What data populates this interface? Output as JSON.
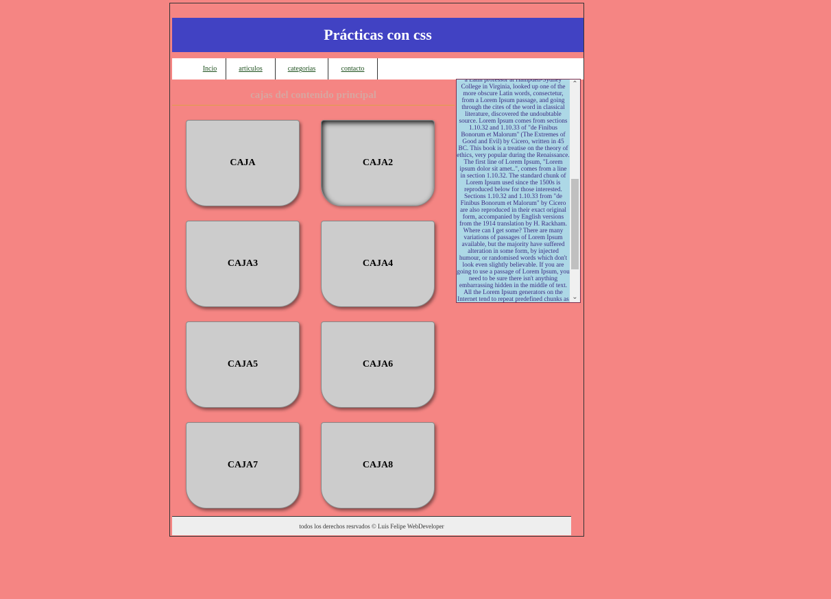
{
  "header": {
    "title": "Prácticas con css"
  },
  "nav": {
    "items": [
      {
        "label": "Incio"
      },
      {
        "label": "articulos"
      },
      {
        "label": "categorias"
      },
      {
        "label": "contacto"
      }
    ]
  },
  "main": {
    "subtitle": "cajas del contenido principal",
    "boxes": [
      {
        "label": "CAJA"
      },
      {
        "label": "CAJA2"
      },
      {
        "label": "CAJA3"
      },
      {
        "label": "CAJA4"
      },
      {
        "label": "CAJA5"
      },
      {
        "label": "CAJA6"
      },
      {
        "label": "CAJA7"
      },
      {
        "label": "CAJA8"
      }
    ]
  },
  "aside": {
    "text": "a Latin professor at Hampden-Sydney College in Virginia, looked up one of the more obscure Latin words, consectetur, from a Lorem Ipsum passage, and going through the cites of the word in classical literature, discovered the undoubtable source. Lorem Ipsum comes from sections 1.10.32 and 1.10.33 of \"de Finibus Bonorum et Malorum\" (The Extremes of Good and Evil) by Cicero, written in 45 BC. This book is a treatise on the theory of ethics, very popular during the Renaissance. The first line of Lorem Ipsum, \"Lorem ipsum dolor sit amet..\", comes from a line in section 1.10.32. The standard chunk of Lorem Ipsum used since the 1500s is reproduced below for those interested. Sections 1.10.32 and 1.10.33 from \"de Finibus Bonorum et Malorum\" by Cicero are also reproduced in their exact original form, accompanied by English versions from the 1914 translation by H. Rackham. Where can I get some? There are many variations of passages of Lorem Ipsum available, but the majority have suffered alteration in some form, by injected humour, or randomised words which don't look even slightly believable. If you are going to use a passage of Lorem Ipsum, you need to be sure there isn't anything embarrassing hidden in the middle of text. All the Lorem Ipsum generators on the Internet tend to repeat predefined chunks as necessary, making this the first true generator on the Internet. It uses",
    "scroll_up_icon": "chevron-up-icon",
    "scroll_down_icon": "chevron-down-icon"
  },
  "footer": {
    "text": "todos los derechos resrvados © Luis Felipe WebDeveloper"
  },
  "colors": {
    "background": "#F58583",
    "header": "#4142C3",
    "box": "#CCCCCC",
    "aside": "#ADD8E6",
    "footer": "#EEEEEE"
  }
}
